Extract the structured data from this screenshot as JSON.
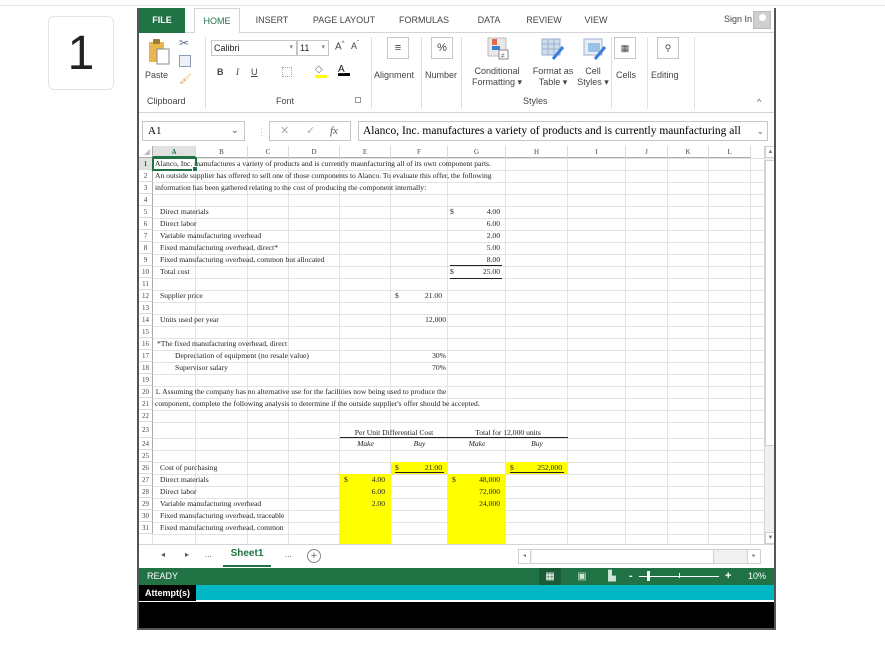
{
  "question_number": "1",
  "ribbon_tabs": [
    "FILE",
    "HOME",
    "INSERT",
    "PAGE LAYOUT",
    "FORMULAS",
    "DATA",
    "REVIEW",
    "VIEW"
  ],
  "active_tab": "HOME",
  "sign_in": "Sign In",
  "ribbon": {
    "paste": "Paste",
    "clipboard": "Clipboard",
    "font_name": "Calibri",
    "font_size": "11",
    "font_group": "Font",
    "bold": "B",
    "italic": "I",
    "underline": "U",
    "alignment": "Alignment",
    "number": "Number",
    "number_icon": "%",
    "conditional_formatting_1": "Conditional",
    "conditional_formatting_2": "Formatting",
    "format_as_table_1": "Format as",
    "format_as_table_2": "Table",
    "cell_styles_1": "Cell",
    "cell_styles_2": "Styles",
    "styles_group": "Styles",
    "cells": "Cells",
    "editing": "Editing",
    "font_color": "#000000",
    "fill_color": "#ffff00"
  },
  "formula_bar": {
    "name_box": "A1",
    "fx": "fx",
    "content": "Alanco, Inc. manufactures a variety of products and is currently maunfacturing all"
  },
  "columns": [
    "A",
    "B",
    "C",
    "D",
    "E",
    "F",
    "G",
    "H",
    "I",
    "J",
    "K",
    "L"
  ],
  "selected_cell": "A1",
  "rows": [
    "1",
    "2",
    "3",
    "4",
    "5",
    "6",
    "7",
    "8",
    "9",
    "10",
    "11",
    "12",
    "13",
    "14",
    "15",
    "16",
    "17",
    "18",
    "19",
    "20",
    "21",
    "22",
    "23",
    "24",
    "25",
    "26",
    "27",
    "28",
    "29",
    "30",
    "31"
  ],
  "cells": {
    "r1": "Alanco, Inc. manufactures a variety of products and is currently maunfacturing all of its own component parts.",
    "r2": "An outside supplier has offered to sell one of those components to Alanco.  To evaluate this offer, the following",
    "r3": "information has been gathered relating to the cost of producing the component internally:",
    "cost_items": [
      {
        "label": "Direct materials",
        "dollar": "$",
        "value": "4.00"
      },
      {
        "label": "Direct labor",
        "dollar": "",
        "value": "6.00"
      },
      {
        "label": "Variable manufacturing overhead",
        "dollar": "",
        "value": "2.00"
      },
      {
        "label": "Fixed manufacturing overhead, direct*",
        "dollar": "",
        "value": "5.00"
      },
      {
        "label": "Fixed manufacturing overhead, common but allocated",
        "dollar": "",
        "value": "8.00"
      },
      {
        "label": "Total cost",
        "dollar": "$",
        "value": "25.00"
      }
    ],
    "supplier_price_label": "Supplier price",
    "supplier_price_dollar": "$",
    "supplier_price": "21.00",
    "units_label": "Units used per year",
    "units": "12,000",
    "footnote": "*The fixed manufacturing overhead, direct",
    "depreciation_label": "Depreciation of equipment (no resale value)",
    "depreciation_pct": "30%",
    "supervisor_label": "Supervisor salary",
    "supervisor_pct": "70%",
    "r20": "1. Assuming the company has no alternative use for the facilities now being used to produce the",
    "r21": "component, complete the following analysis to determine if the outside supplier's offer should be accepted.",
    "per_unit_header": "Per Unit Differential Cost",
    "total_header": "Total for 12,000 units",
    "make": "Make",
    "buy": "Buy",
    "analysis": [
      {
        "label": "Cost of purchasing",
        "pu_make_d": "",
        "pu_make": "",
        "pu_buy_d": "$",
        "pu_buy": "21.00",
        "t_make_d": "",
        "t_make": "",
        "t_buy_d": "$",
        "t_buy": "252,000"
      },
      {
        "label": "Direct materials",
        "pu_make_d": "$",
        "pu_make": "4.00",
        "pu_buy_d": "",
        "pu_buy": "",
        "t_make_d": "$",
        "t_make": "48,000",
        "t_buy_d": "",
        "t_buy": ""
      },
      {
        "label": "Direct labor",
        "pu_make_d": "",
        "pu_make": "6.00",
        "pu_buy_d": "",
        "pu_buy": "",
        "t_make_d": "",
        "t_make": "72,000",
        "t_buy_d": "",
        "t_buy": ""
      },
      {
        "label": "Variable manufacturing overhead",
        "pu_make_d": "",
        "pu_make": "2.00",
        "pu_buy_d": "",
        "pu_buy": "",
        "t_make_d": "",
        "t_make": "24,000",
        "t_buy_d": "",
        "t_buy": ""
      },
      {
        "label": "Fixed manufacturing overhead, traceable",
        "pu_make_d": "",
        "pu_make": "",
        "pu_buy_d": "",
        "pu_buy": "",
        "t_make_d": "",
        "t_make": "",
        "t_buy_d": "",
        "t_buy": ""
      },
      {
        "label": "Fixed manufacturing overhead, common",
        "pu_make_d": "",
        "pu_make": "",
        "pu_buy_d": "",
        "pu_buy": "",
        "t_make_d": "",
        "t_make": "",
        "t_buy_d": "",
        "t_buy": ""
      }
    ]
  },
  "sheet_tabs": [
    "Sheet1"
  ],
  "sheet_nav_more": "...",
  "status": {
    "ready": "READY",
    "zoom": "10%",
    "zoom_minus": "-",
    "zoom_plus": "+"
  },
  "attempt_label": "Attempt(s)",
  "colors": {
    "excel_green": "#217346",
    "highlight_yellow": "#ffff00",
    "attempt_bar": "#00b7c3"
  }
}
